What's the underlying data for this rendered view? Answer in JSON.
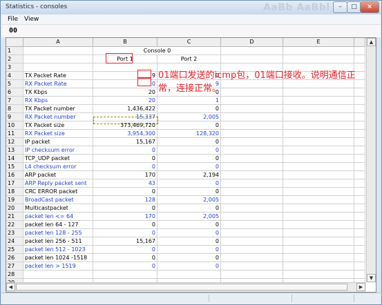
{
  "window": {
    "title": "Statistics - consoles",
    "ghost_text": "AaBb AaBbl AaBb"
  },
  "menu": [
    "File",
    "View"
  ],
  "toolbar": {
    "cell_ref": "00"
  },
  "columns": [
    "A",
    "B",
    "C",
    "D",
    "E"
  ],
  "header": {
    "console": "Console 0",
    "port1": "Port 1",
    "port2": "Port 2"
  },
  "rows": [
    {
      "n": "1",
      "a": "",
      "b": "",
      "c": "",
      "blue": false
    },
    {
      "n": "2",
      "a": "",
      "b": "",
      "c": "",
      "blue": false
    },
    {
      "n": "3",
      "a": "",
      "b": "",
      "c": "",
      "blue": false
    },
    {
      "n": "4",
      "a": "TX Packet Rate",
      "b": "9",
      "c": "0",
      "blue": false
    },
    {
      "n": "5",
      "a": "RX Packet Rate",
      "b": "0",
      "c": "9",
      "blue": true
    },
    {
      "n": "6",
      "a": "TX Kbps",
      "b": "20",
      "c": "0",
      "blue": false
    },
    {
      "n": "7",
      "a": "RX Kbps",
      "b": "20",
      "c": "1",
      "blue": true
    },
    {
      "n": "8",
      "a": "TX Packet number",
      "b": "1,436,422",
      "c": "0",
      "blue": false
    },
    {
      "n": "9",
      "a": "RX Packet number",
      "b": "15,337",
      "c": "2,005",
      "blue": true
    },
    {
      "n": "10",
      "a": "TX Packet size",
      "b": "373,469,720",
      "c": "0",
      "blue": false
    },
    {
      "n": "11",
      "a": "RX Packet size",
      "b": "3,954,300",
      "c": "128,320",
      "blue": true
    },
    {
      "n": "12",
      "a": "IP packet",
      "b": "15,167",
      "c": "0",
      "blue": false
    },
    {
      "n": "13",
      "a": "IP checksum error",
      "b": "0",
      "c": "0",
      "blue": true
    },
    {
      "n": "14",
      "a": "TCP_UDP packet",
      "b": "0",
      "c": "0",
      "blue": false
    },
    {
      "n": "15",
      "a": "L4 checksum error",
      "b": "0",
      "c": "0",
      "blue": true
    },
    {
      "n": "16",
      "a": "ARP packet",
      "b": "170",
      "c": "2,194",
      "blue": false
    },
    {
      "n": "17",
      "a": "ARP Reply packet sent",
      "b": "43",
      "c": "0",
      "blue": true
    },
    {
      "n": "18",
      "a": "CRC ERROR packet",
      "b": "0",
      "c": "0",
      "blue": false
    },
    {
      "n": "19",
      "a": "BroadCast packet",
      "b": "128",
      "c": "2,005",
      "blue": true
    },
    {
      "n": "20",
      "a": "Multicastpacket",
      "b": "0",
      "c": "0",
      "blue": false
    },
    {
      "n": "21",
      "a": "packet len <= 64",
      "b": "170",
      "c": "2,005",
      "blue": true
    },
    {
      "n": "22",
      "a": "packet len 64 - 127",
      "b": "0",
      "c": "0",
      "blue": false
    },
    {
      "n": "23",
      "a": "packet len 128 - 255",
      "b": "0",
      "c": "0",
      "blue": true
    },
    {
      "n": "24",
      "a": "packet len 256 - 511",
      "b": "15,167",
      "c": "0",
      "blue": false
    },
    {
      "n": "25",
      "a": "packet len 512 - 1023",
      "b": "0",
      "c": "0",
      "blue": true
    },
    {
      "n": "26",
      "a": "packet len 1024 -1518",
      "b": "0",
      "c": "0",
      "blue": false
    },
    {
      "n": "27",
      "a": "packet len > 1519",
      "b": "0",
      "c": "0",
      "blue": true
    },
    {
      "n": "28",
      "a": "",
      "b": "",
      "c": "",
      "blue": false
    },
    {
      "n": "29",
      "a": "",
      "b": "",
      "c": "",
      "blue": false
    }
  ],
  "annotation": "01端口发送的icmp包，01端口接收。说明通信正常，连接正常。",
  "colors": {
    "accent_red": "#e8202a",
    "alt_row_blue": "#1f3fd3"
  }
}
